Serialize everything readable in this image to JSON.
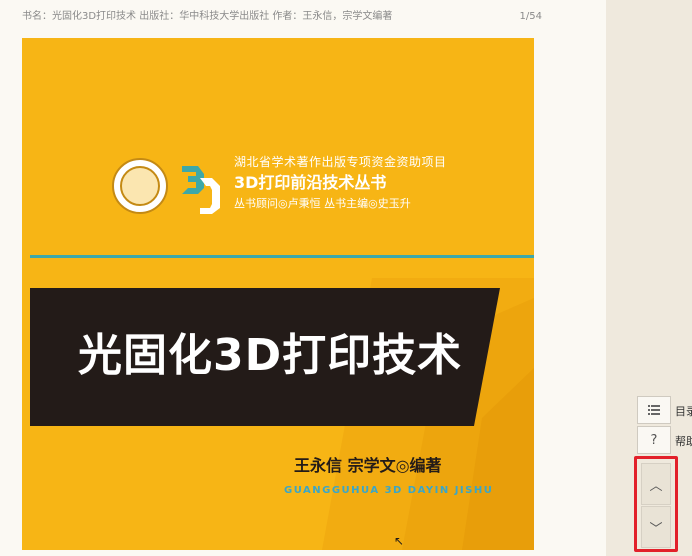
{
  "header": {
    "book_meta": "书名：光固化3D打印技术  出版社：华中科技大学出版社  作者：王永信，宗学文编著",
    "page_counter": "1/54"
  },
  "cover": {
    "series_note": "湖北省学术著作出版专项资金资助项目",
    "series_name": "3D打印前沿技术丛书",
    "series_editors": "丛书顾问◎卢秉恒   丛书主编◎史玉升",
    "title": "光固化3D打印技术",
    "authors": "王永信   宗学文◎编著",
    "pinyin": "GUANGGUHUA 3D DAYIN JISHU",
    "colors": {
      "background": "#f7b515",
      "band": "#231b18",
      "accent": "#3ea8a8",
      "pinyin": "#3aa6c8"
    }
  },
  "toolbar": {
    "toc_label": "目录",
    "help_label": "帮助",
    "toc_icon": "list-icon",
    "help_icon": "question-icon",
    "prev_icon": "chevron-up-icon",
    "next_icon": "chevron-down-icon"
  },
  "highlight_color": "#e2202a"
}
